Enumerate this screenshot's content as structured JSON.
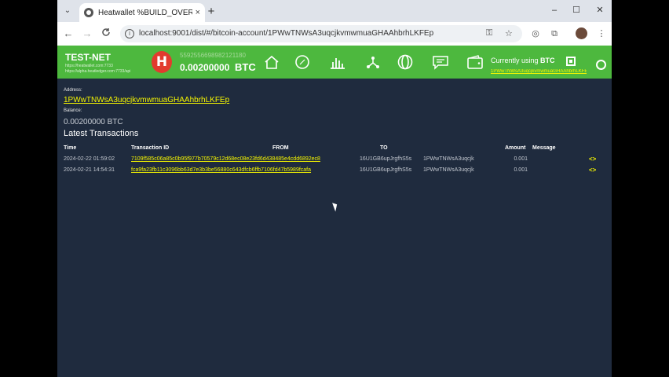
{
  "browser": {
    "tab_title": "Heatwallet %BUILD_OVERRIDE...",
    "tab_close": "×",
    "new_tab": "+",
    "window_controls": {
      "minimize": "–",
      "maximize": "☐",
      "close": "✕"
    },
    "nav": {
      "back": "←",
      "forward": "→",
      "reload": "C"
    },
    "url": "localhost:9001/dist/#/bitcoin-account/1PWwTNWsA3uqcjkvmwmuaGHAAhbrhLKFEp",
    "icons": [
      "search-icon",
      "key-icon",
      "star-icon",
      "extension-icon",
      "menu-icon"
    ]
  },
  "header": {
    "network": "TEST-NET",
    "urls": [
      "https://heatwallet.com:7733",
      "https://alpha.heatledger.com:7733/api"
    ],
    "logo_letter": "H",
    "account_number": "5592556698982121180",
    "balance": "0.00200000",
    "currency": "BTC",
    "currently_using_prefix": "Currently using",
    "currently_using_currency": "BTC",
    "current_address": "1PWwTNWsA3uqcjkvmwmuaGHAAhbrhLKFEp",
    "colors": {
      "bar": "#4db83e",
      "link": "#f6f600",
      "logo": "#e23b2e"
    },
    "nav_icons": [
      "home-icon",
      "compass-icon",
      "chart-icon",
      "network-icon",
      "circles-icon",
      "chat-icon",
      "wallet-icon",
      "qr-code-icon",
      "face-icon"
    ]
  },
  "main": {
    "address_label": "Address:",
    "address": "1PWwTNWsA3uqcjkvmwmuaGHAAhbrhLKFEp",
    "balance_label": "Balance:",
    "balance_text": "0.00200000 BTC",
    "latest_title": "Latest Transactions",
    "columns": [
      "Time",
      "Transaction ID",
      "FROM",
      "TO",
      "Amount",
      "Message"
    ],
    "rows": [
      {
        "time": "2024-02-22 01:59:02",
        "txid": "7109f585c06a85c0b95f977b70579c12d68ec08e23fd6d438485e4cdd6892ec8",
        "from": "16U1GB6upJrgfhS5s",
        "to": "1PWwTNWsA3uqcjk",
        "amount": "0.001",
        "message": ""
      },
      {
        "time": "2024-02-21 14:54:31",
        "txid": "fca9fa23fb11c3096bb63d7e3b3be56880c643dfcb6ffb7106fd47b5989fcafa",
        "from": "16U1GB6upJrgfhS5s",
        "to": "1PWwTNWsA3uqcjk",
        "amount": "0.001",
        "message": ""
      }
    ],
    "expand_glyph": "<>"
  }
}
